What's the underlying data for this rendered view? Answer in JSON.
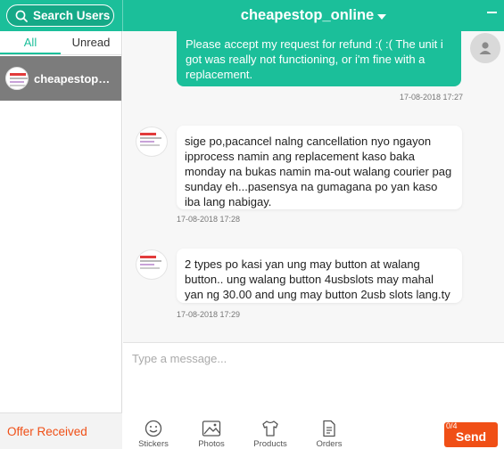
{
  "header": {
    "search_label": "Search Users",
    "chat_title": "cheapestop_online"
  },
  "sidebar": {
    "tabs": [
      {
        "label": "All",
        "active": true
      },
      {
        "label": "Unread",
        "active": false
      }
    ],
    "conversations": [
      {
        "name": "cheapestop_online"
      }
    ],
    "offer_label": "Offer Received"
  },
  "messages": [
    {
      "direction": "out",
      "text": "Please accept my request for refund :( :( The unit i got was really not functioning, or i'm fine with a replacement.",
      "time": "17-08-2018 17:27"
    },
    {
      "direction": "in",
      "text": "sige po,pacancel nalng cancellation nyo ngayon ipprocess namin ang replacement kaso baka monday na bukas namin ma-out walang courier pag sunday eh...pasensya na gumagana po yan kaso iba lang nabigay.",
      "time": "17-08-2018 17:28"
    },
    {
      "direction": "in",
      "text": "2 types po kasi yan ung may button at walang button.. ung walang button 4usbslots may mahal yan ng 30.00 and ung may button 2usb slots lang.ty",
      "time": "17-08-2018 17:29"
    }
  ],
  "composer": {
    "placeholder": "Type a message...",
    "tools": [
      {
        "label": "Stickers",
        "icon": "smiley-icon"
      },
      {
        "label": "Photos",
        "icon": "image-icon"
      },
      {
        "label": "Products",
        "icon": "shirt-icon"
      },
      {
        "label": "Orders",
        "icon": "document-icon"
      }
    ],
    "char_count": "0/4",
    "send_label": "Send"
  },
  "colors": {
    "accent": "#1bbf9a",
    "send": "#f04f16",
    "selected_conversation": "#7c7c7c"
  }
}
